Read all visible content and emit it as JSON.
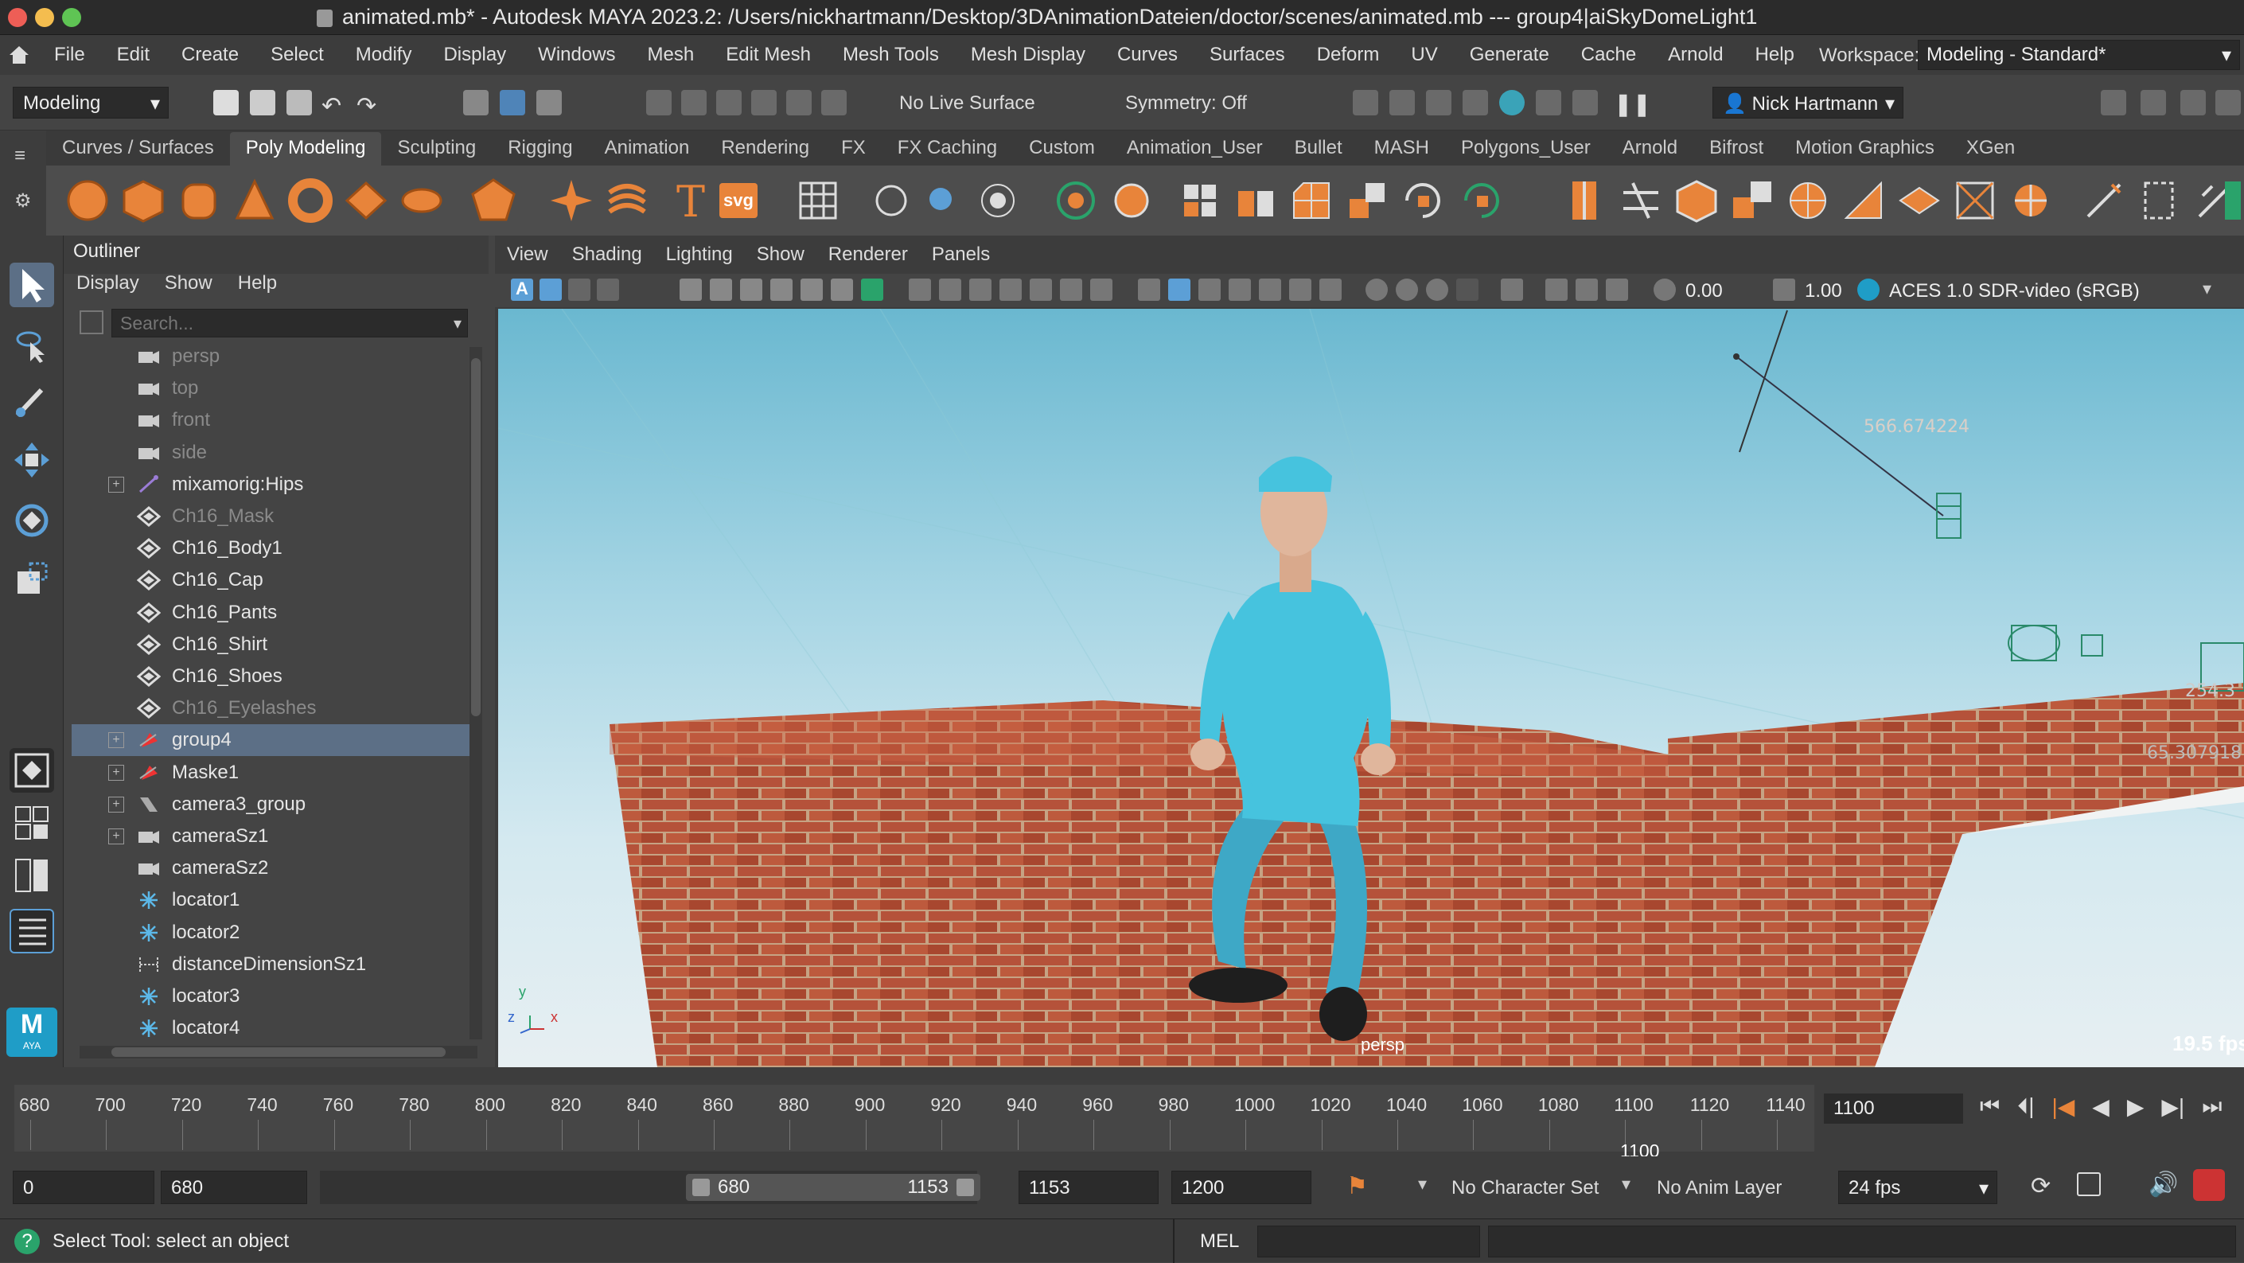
{
  "window": {
    "title": "animated.mb* - Autodesk MAYA 2023.2: /Users/nickhartmann/Desktop/3DAnimationDateien/doctor/scenes/animated.mb  ---   group4|aiSkyDomeLight1"
  },
  "menubar": {
    "items": [
      "File",
      "Edit",
      "Create",
      "Select",
      "Modify",
      "Display",
      "Windows",
      "Mesh",
      "Edit Mesh",
      "Mesh Tools",
      "Mesh Display",
      "Curves",
      "Surfaces",
      "Deform",
      "UV",
      "Generate",
      "Cache",
      "Arnold",
      "Help"
    ],
    "workspace_label": "Workspace:",
    "workspace_value": "Modeling - Standard*"
  },
  "statusline": {
    "mode": "Modeling",
    "live_surface": "No Live Surface",
    "symmetry": "Symmetry: Off",
    "user": "Nick Hartmann"
  },
  "shelf": {
    "tabs": [
      "Curves / Surfaces",
      "Poly Modeling",
      "Sculpting",
      "Rigging",
      "Animation",
      "Rendering",
      "FX",
      "FX Caching",
      "Custom",
      "Animation_User",
      "Bullet",
      "MASH",
      "Polygons_User",
      "Arnold",
      "Bifrost",
      "Motion Graphics",
      "XGen"
    ],
    "active_tab": "Poly Modeling",
    "text_icon": "T",
    "svg_icon": "svg"
  },
  "outliner": {
    "title": "Outliner",
    "menu": [
      "Display",
      "Show",
      "Help"
    ],
    "search_placeholder": "Search...",
    "items": [
      {
        "label": "persp",
        "icon": "camera-icon",
        "dim": true,
        "expandable": false
      },
      {
        "label": "top",
        "icon": "camera-icon",
        "dim": true,
        "expandable": false
      },
      {
        "label": "front",
        "icon": "camera-icon",
        "dim": true,
        "expandable": false
      },
      {
        "label": "side",
        "icon": "camera-icon",
        "dim": true,
        "expandable": false
      },
      {
        "label": "mixamorig:Hips",
        "icon": "joint-icon",
        "dim": false,
        "expandable": true
      },
      {
        "label": "Ch16_Mask",
        "icon": "mesh-icon",
        "dim": true,
        "expandable": false
      },
      {
        "label": "Ch16_Body1",
        "icon": "mesh-icon",
        "dim": false,
        "expandable": false
      },
      {
        "label": "Ch16_Cap",
        "icon": "mesh-icon",
        "dim": false,
        "expandable": false
      },
      {
        "label": "Ch16_Pants",
        "icon": "mesh-icon",
        "dim": false,
        "expandable": false
      },
      {
        "label": "Ch16_Shirt",
        "icon": "mesh-icon",
        "dim": false,
        "expandable": false
      },
      {
        "label": "Ch16_Shoes",
        "icon": "mesh-icon",
        "dim": false,
        "expandable": false
      },
      {
        "label": "Ch16_Eyelashes",
        "icon": "mesh-icon",
        "dim": true,
        "expandable": false
      },
      {
        "label": "group4",
        "icon": "group-icon",
        "dim": false,
        "expandable": true,
        "selected": true
      },
      {
        "label": "Maske1",
        "icon": "group-icon",
        "dim": false,
        "expandable": true
      },
      {
        "label": "camera3_group",
        "icon": "camera-group-icon",
        "dim": false,
        "expandable": true
      },
      {
        "label": "cameraSz1",
        "icon": "camera-icon",
        "dim": false,
        "expandable": true
      },
      {
        "label": "cameraSz2",
        "icon": "camera-icon",
        "dim": false,
        "expandable": false
      },
      {
        "label": "locator1",
        "icon": "locator-icon",
        "dim": false,
        "expandable": false
      },
      {
        "label": "locator2",
        "icon": "locator-icon",
        "dim": false,
        "expandable": false
      },
      {
        "label": "distanceDimensionSz1",
        "icon": "distance-icon",
        "dim": false,
        "expandable": false
      },
      {
        "label": "locator3",
        "icon": "locator-icon",
        "dim": false,
        "expandable": false
      },
      {
        "label": "locator4",
        "icon": "locator-icon",
        "dim": false,
        "expandable": false
      }
    ]
  },
  "viewport": {
    "menu": [
      "View",
      "Shading",
      "Lighting",
      "Show",
      "Renderer",
      "Panels"
    ],
    "exposure": "0.00",
    "gamma": "1.00",
    "color_space": "ACES 1.0 SDR-video (sRGB)",
    "camera_label": "persp",
    "fps_readout": "19.5 fps",
    "distance_readout_1": "566.674224",
    "distance_readout_2": "65.307918",
    "distance_readout_3": "254.3",
    "axis_y": "y",
    "axis_z": "z",
    "axis_x": "x"
  },
  "timeline": {
    "ticks": [
      "680",
      "700",
      "720",
      "740",
      "760",
      "780",
      "800",
      "820",
      "840",
      "860",
      "880",
      "900",
      "920",
      "940",
      "960",
      "980",
      "1000",
      "1020",
      "1040",
      "1060",
      "1080",
      "1100",
      "1120",
      "1140"
    ],
    "current_frame_marker": "1100",
    "current_frame": "1100"
  },
  "range": {
    "anim_start": "0",
    "playback_start": "680",
    "slider_start": "680",
    "slider_end": "1153",
    "playback_end": "1153",
    "anim_end": "1200",
    "character_set": "No Character Set",
    "anim_layer": "No Anim Layer",
    "fps": "24 fps"
  },
  "cmdline": {
    "help_text": "Select Tool: select an object",
    "language": "MEL"
  },
  "colors": {
    "accent_blue": "#5c9fd6",
    "selection": "#5c6f86",
    "shelf_orange": "#e8843a",
    "brick": "#b5523a",
    "scrubs": "#46c3de"
  }
}
